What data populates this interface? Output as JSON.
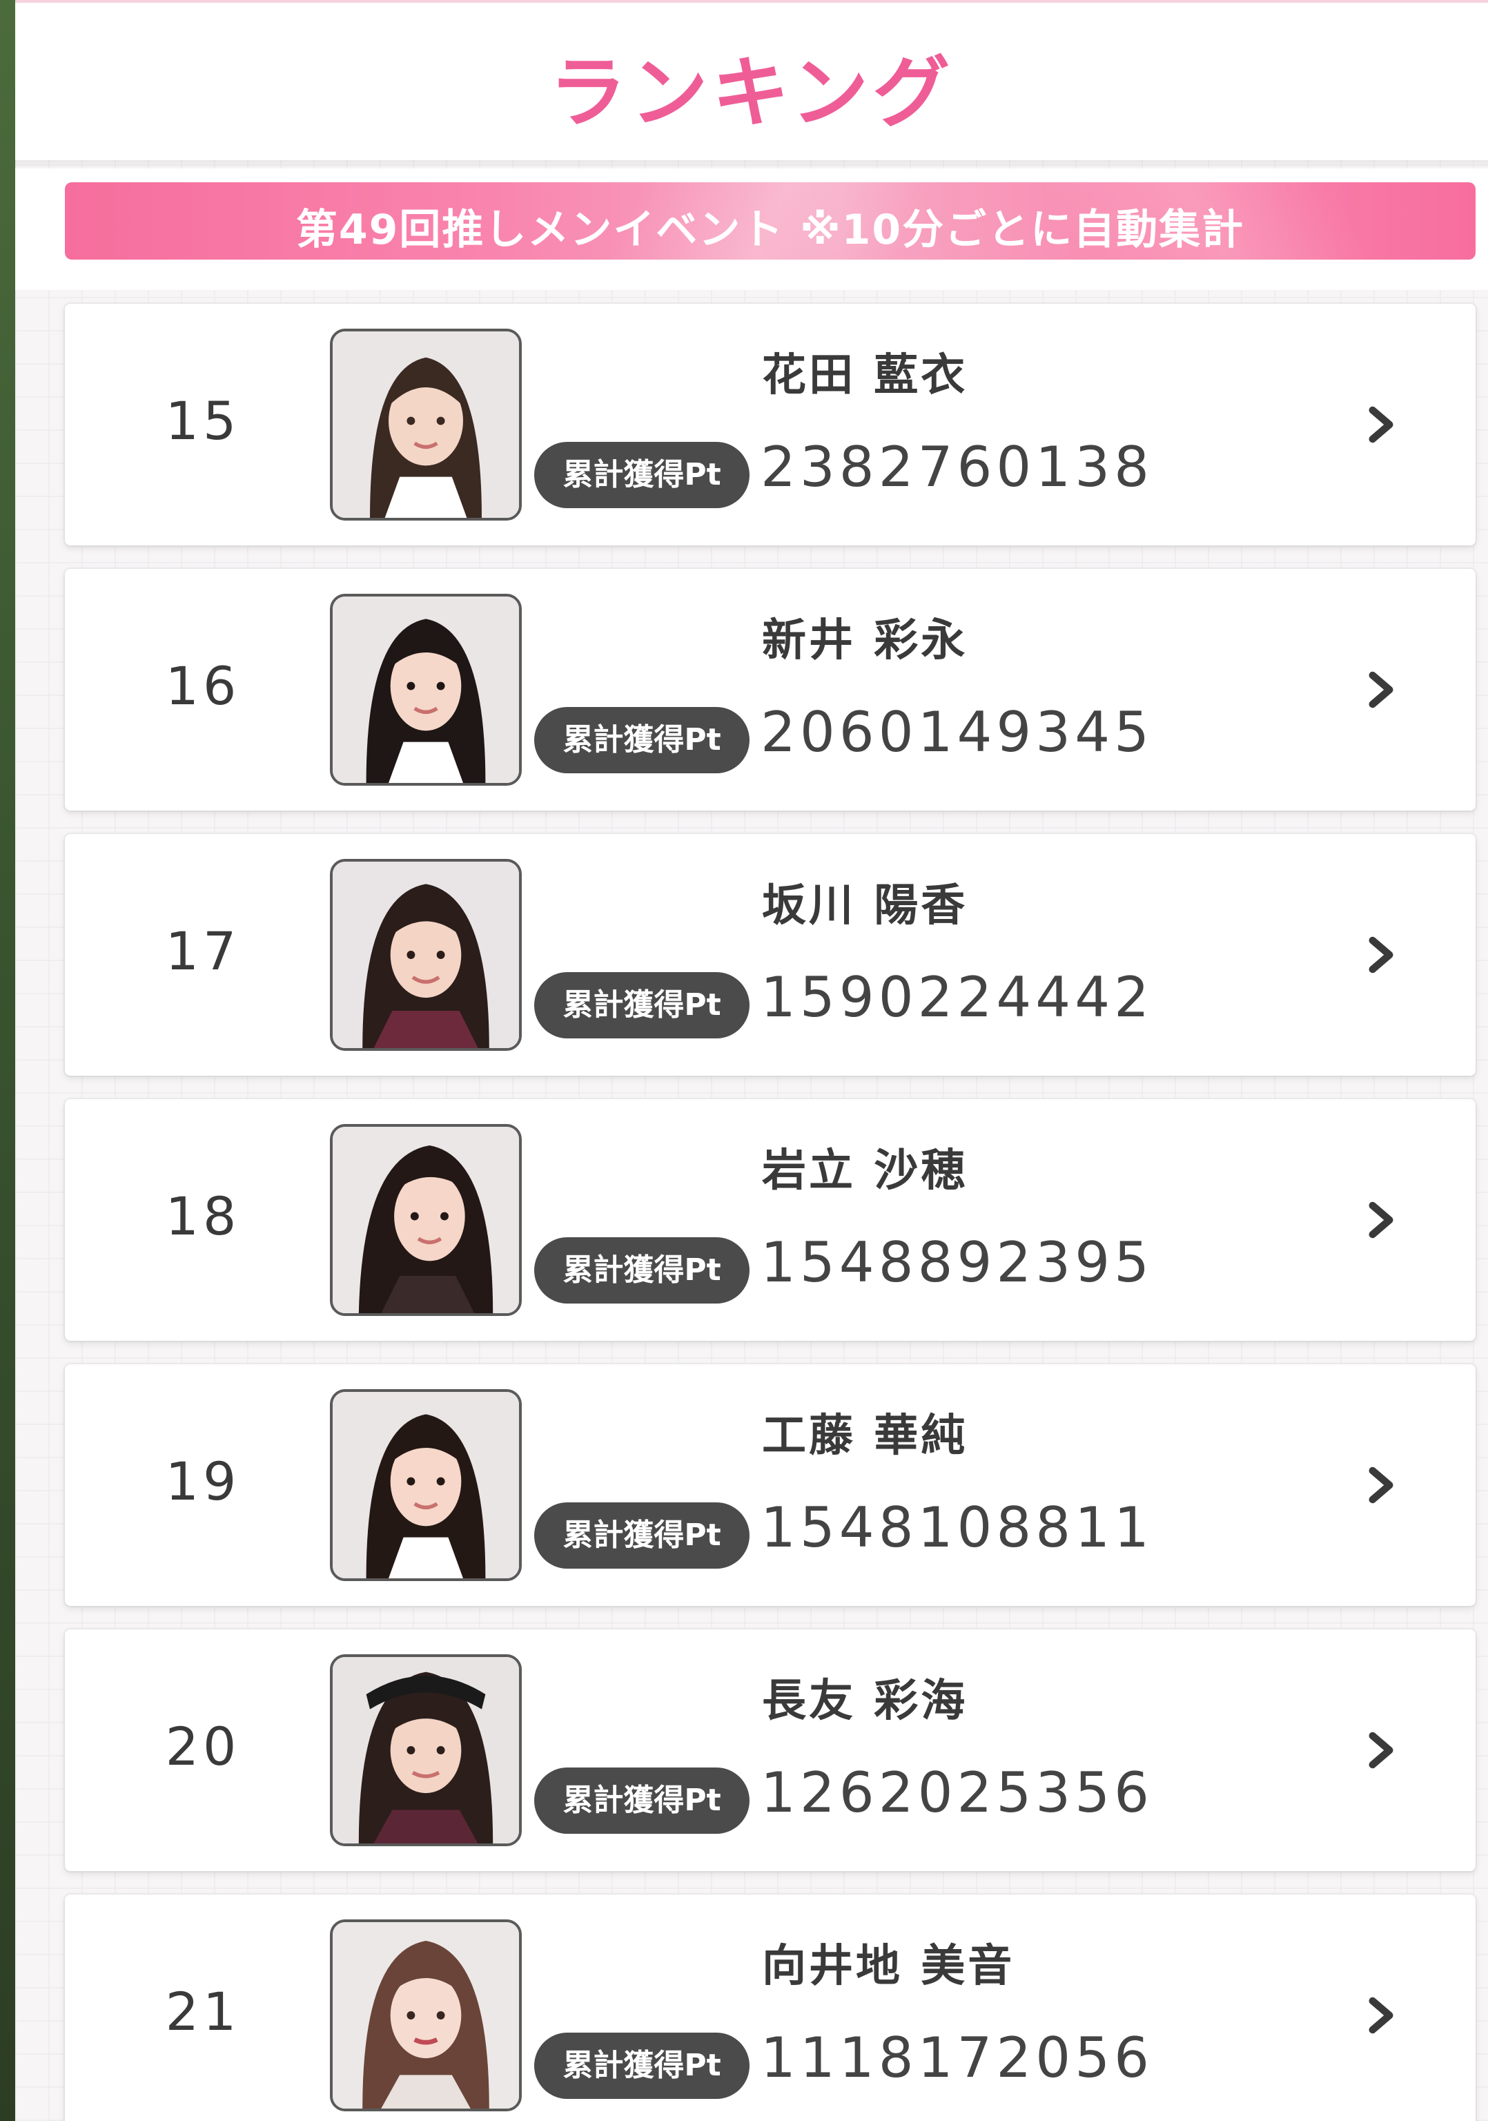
{
  "header": {
    "title": "ランキング"
  },
  "event_banner": {
    "text": "第49回推しメンイベント ※10分ごとに自動集計"
  },
  "rankings": [
    {
      "rank": "15",
      "name": "花田 藍衣",
      "badge": "累計獲得Pt",
      "points": "2382760138"
    },
    {
      "rank": "16",
      "name": "新井 彩永",
      "badge": "累計獲得Pt",
      "points": "2060149345"
    },
    {
      "rank": "17",
      "name": "坂川 陽香",
      "badge": "累計獲得Pt",
      "points": "1590224442"
    },
    {
      "rank": "18",
      "name": "岩立 沙穂",
      "badge": "累計獲得Pt",
      "points": "1548892395"
    },
    {
      "rank": "19",
      "name": "工藤 華純",
      "badge": "累計獲得Pt",
      "points": "1548108811"
    },
    {
      "rank": "20",
      "name": "長友 彩海",
      "badge": "累計獲得Pt",
      "points": "1262025356"
    },
    {
      "rank": "21",
      "name": "向井地 美音",
      "badge": "累計獲得Pt",
      "points": "1118172056"
    }
  ],
  "colors": {
    "accent_pink": "#ef5d97",
    "badge_dark": "#4b4b4b",
    "text_dark": "#3a3a3a"
  },
  "icons": {
    "row_action": "chevron-right-icon",
    "avatar": "member-photo"
  }
}
